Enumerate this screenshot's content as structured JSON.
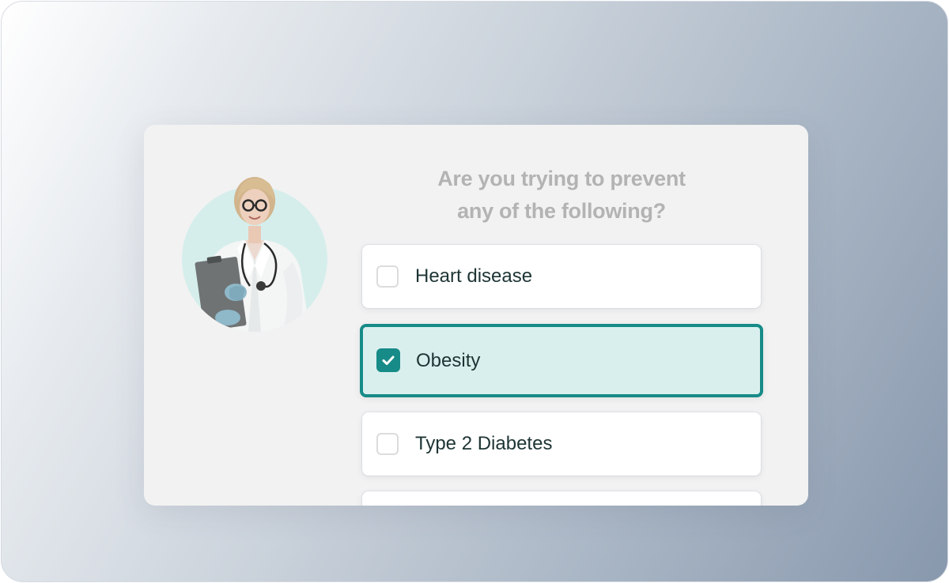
{
  "question": {
    "line1": "Are you trying to prevent",
    "line2": "any of the following?"
  },
  "options": [
    {
      "label": "Heart disease",
      "checked": false
    },
    {
      "label": "Obesity",
      "checked": true
    },
    {
      "label": "Type 2 Diabetes",
      "checked": false
    },
    {
      "label": "",
      "checked": false
    }
  ],
  "colors": {
    "accent": "#168b88",
    "selected_fill": "#d9efee",
    "question_text": "#b3b3b3",
    "option_text": "#1e3434",
    "avatar_bg": "#d5eeec"
  },
  "icons": {
    "checkmark": "check-icon",
    "avatar": "doctor-avatar"
  }
}
